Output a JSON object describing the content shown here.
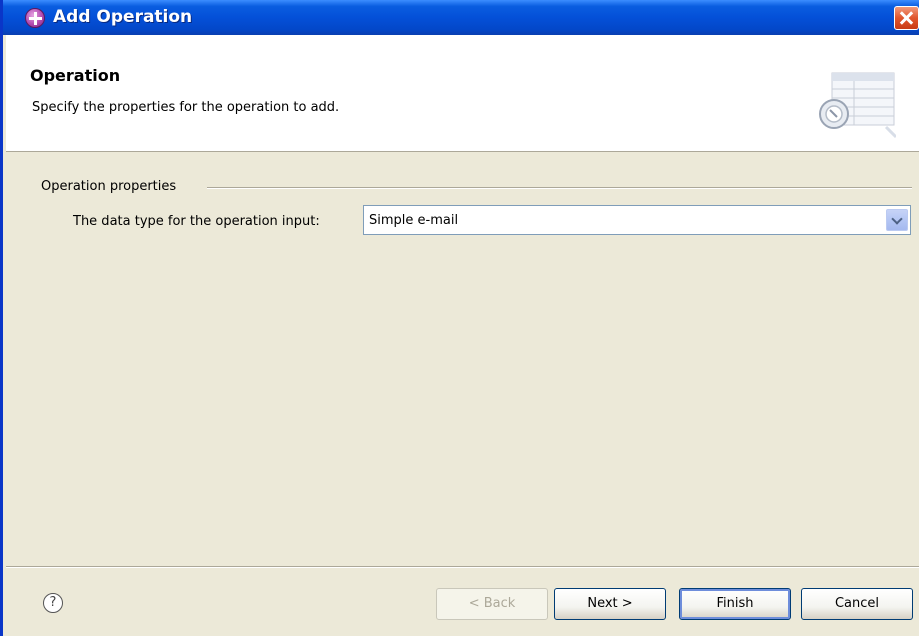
{
  "window": {
    "title": "Add Operation"
  },
  "header": {
    "title": "Operation",
    "description": "Specify the properties for the operation to add."
  },
  "group": {
    "label": "Operation properties",
    "field_label": "The data type for the operation input:",
    "field_value": "Simple e-mail"
  },
  "buttons": {
    "back": "< Back",
    "next": "Next >",
    "finish": "Finish",
    "cancel": "Cancel"
  },
  "icons": {
    "window": "add-operation-icon",
    "close": "close-icon",
    "help": "help-icon",
    "banner": "wizard-table-icon"
  },
  "colors": {
    "title_bar": "#0450D8",
    "dialog_bg": "#ECE9D8",
    "close": "#E0552C"
  }
}
